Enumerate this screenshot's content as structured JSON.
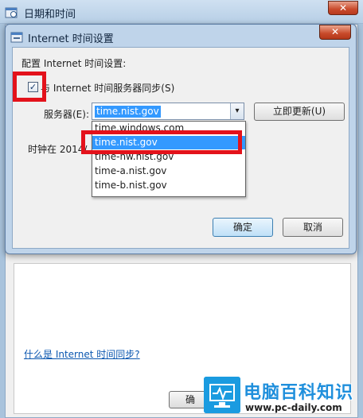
{
  "outer_window": {
    "title": "日期和时间",
    "close_glyph": "✕",
    "help_link": "什么是 Internet 时间同步?",
    "ok_partial": "确"
  },
  "dialog": {
    "title": "Internet 时间设置",
    "close_glyph": "✕",
    "config_label": "配置 Internet 时间设置:",
    "sync_checked": true,
    "check_glyph": "✓",
    "sync_label": "与 Internet 时间服务器同步(S)",
    "server_label": "服务器(E):",
    "server_value": "time.nist.gov",
    "dropdown_arrow": "▾",
    "update_button": "立即更新(U)",
    "clock_text": "时钟在 2014/",
    "dropdown_options": [
      "time.windows.com",
      "time.nist.gov",
      "time-nw.nist.gov",
      "time-a.nist.gov",
      "time-b.nist.gov"
    ],
    "selected_option": "time.nist.gov",
    "ok_button": "确定",
    "cancel_button": "取消"
  },
  "highlight_color": "#e3121b",
  "watermark": {
    "title": "电脑百科知识",
    "url": "www.pc-daily.com"
  }
}
